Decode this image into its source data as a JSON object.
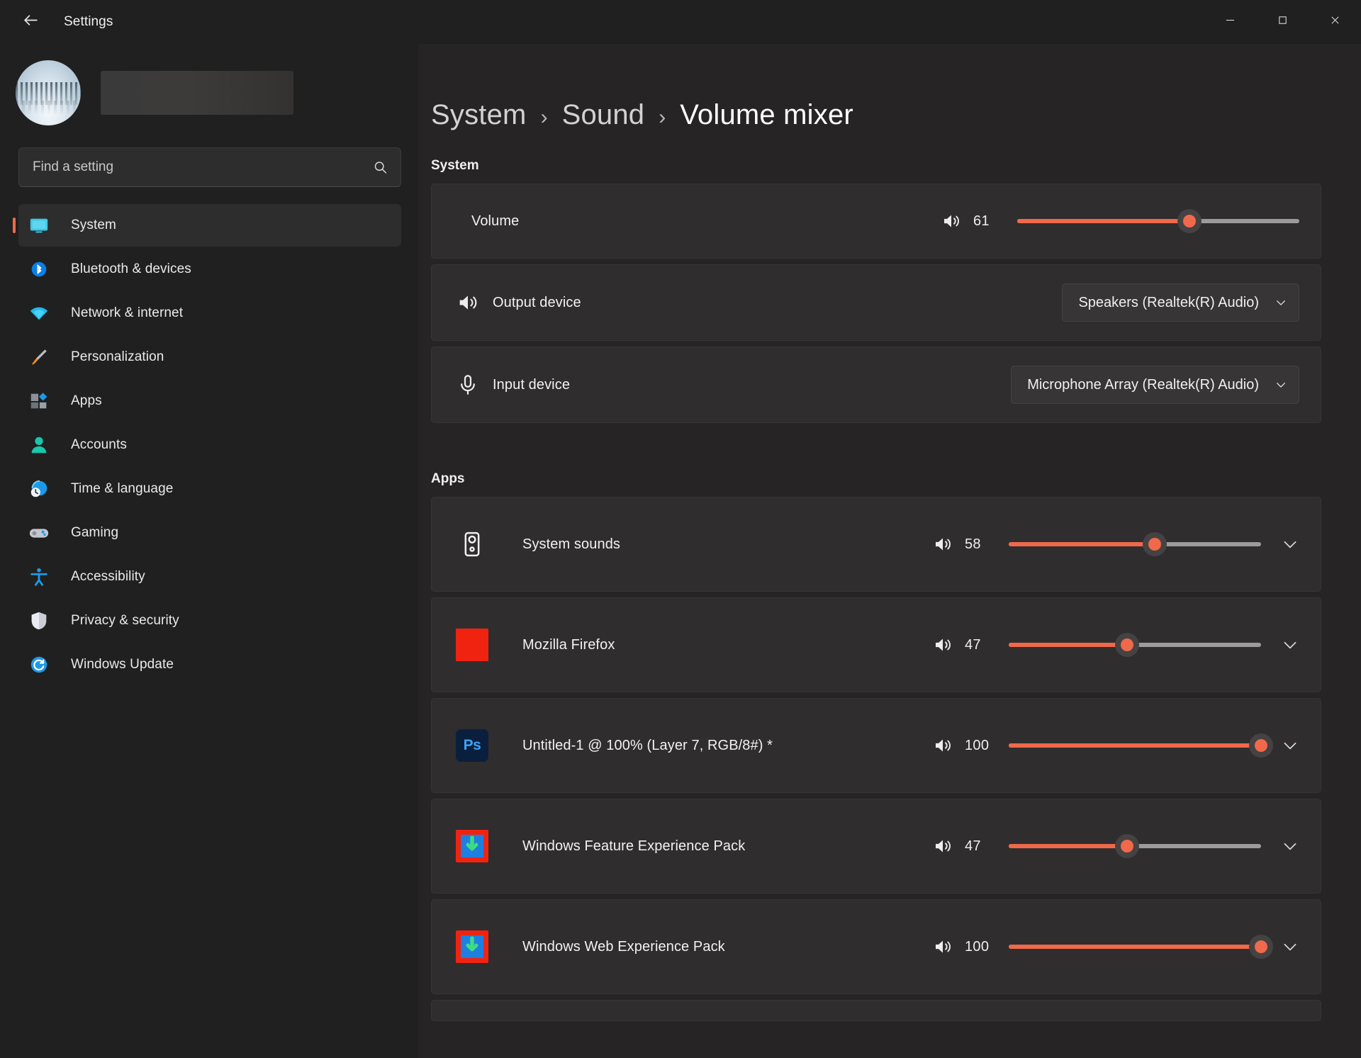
{
  "window": {
    "title": "Settings",
    "back_icon": "back-arrow-icon",
    "controls": {
      "minimize": "minimize-icon",
      "maximize": "maximize-icon",
      "close": "close-icon"
    }
  },
  "sidebar": {
    "profile": {
      "avatar_alt": "user-avatar",
      "name_redacted": ""
    },
    "search": {
      "placeholder": "Find a setting",
      "value": "",
      "icon": "search-icon"
    },
    "items": [
      {
        "label": "System",
        "icon": "monitor-icon",
        "selected": true
      },
      {
        "label": "Bluetooth & devices",
        "icon": "bluetooth-icon",
        "selected": false
      },
      {
        "label": "Network & internet",
        "icon": "wifi-icon",
        "selected": false
      },
      {
        "label": "Personalization",
        "icon": "paintbrush-icon",
        "selected": false
      },
      {
        "label": "Apps",
        "icon": "apps-icon",
        "selected": false
      },
      {
        "label": "Accounts",
        "icon": "person-icon",
        "selected": false
      },
      {
        "label": "Time & language",
        "icon": "clock-globe-icon",
        "selected": false
      },
      {
        "label": "Gaming",
        "icon": "gamepad-icon",
        "selected": false
      },
      {
        "label": "Accessibility",
        "icon": "accessibility-icon",
        "selected": false
      },
      {
        "label": "Privacy & security",
        "icon": "shield-icon",
        "selected": false
      },
      {
        "label": "Windows Update",
        "icon": "update-refresh-icon",
        "selected": false
      }
    ]
  },
  "main": {
    "breadcrumb": {
      "root": "System",
      "middle": "Sound",
      "current": "Volume mixer",
      "separator": "›"
    },
    "system": {
      "heading": "System",
      "volume": {
        "label": "Volume",
        "icon": "speaker-icon",
        "value": "61",
        "percent": 61
      },
      "output_device": {
        "label": "Output device",
        "icon": "speaker-icon",
        "value": "Speakers (Realtek(R) Audio)",
        "chevron": "chevron-down-icon"
      },
      "input_device": {
        "label": "Input device",
        "icon": "microphone-icon",
        "value": "Microphone Array (Realtek(R) Audio)",
        "chevron": "chevron-down-icon"
      }
    },
    "apps": {
      "heading": "Apps",
      "rows": [
        {
          "name": "System sounds",
          "icon": "system-sounds-icon",
          "value": "58",
          "percent": 58,
          "chevron": "chevron-down-icon"
        },
        {
          "name": "Mozilla Firefox",
          "icon": "firefox-icon",
          "value": "47",
          "percent": 47,
          "chevron": "chevron-down-icon"
        },
        {
          "name": "Untitled-1 @ 100% (Layer 7, RGB/8#) *",
          "icon": "photoshop-icon",
          "icon_text": "Ps",
          "value": "100",
          "percent": 100,
          "chevron": "chevron-down-icon"
        },
        {
          "name": "Windows Feature Experience Pack",
          "icon": "microsoft-store-icon",
          "value": "47",
          "percent": 47,
          "chevron": "chevron-down-icon"
        },
        {
          "name": "Windows Web Experience Pack",
          "icon": "microsoft-store-icon",
          "value": "100",
          "percent": 100,
          "chevron": "chevron-down-icon"
        }
      ]
    }
  },
  "colors": {
    "accent": "#f0694a",
    "track": "#9c9c9c",
    "window_bg": "#202020",
    "main_bg": "#272425",
    "card_bg": "#302d2e"
  }
}
